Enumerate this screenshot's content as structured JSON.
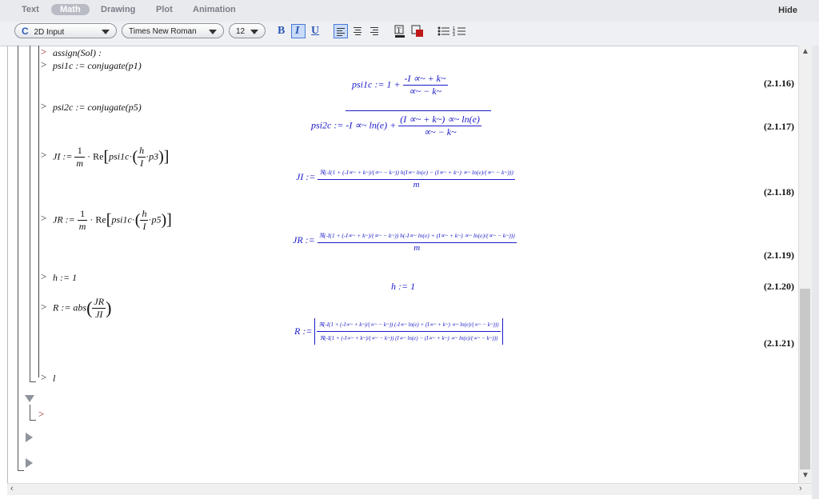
{
  "tabs": [
    {
      "label": "Text",
      "active": false
    },
    {
      "label": "Math",
      "active": true
    },
    {
      "label": "Drawing",
      "active": false
    },
    {
      "label": "Plot",
      "active": false
    },
    {
      "label": "Animation",
      "active": false
    }
  ],
  "hide_label": "Hide",
  "format_bar": {
    "input_mode": "2D Input",
    "input_mode_icon": "C",
    "font": "Times New Roman",
    "size": "12",
    "bold": "B",
    "italic": "I",
    "underline": "U"
  },
  "input_prompt": ">",
  "commands": {
    "assign": "assign(Sol) :",
    "psi1c": "psi1c := conjugate(p1)",
    "psi2c": "psi2c := conjugate(p5)",
    "JI_lhs": "JI :=",
    "JR_lhs": "JR :=",
    "h": "h := 1",
    "R_lhs": "R := abs",
    "one": "1",
    "m": "m",
    "Re": "Re",
    "psi1c_name": "psi1c",
    "h_sym": "h",
    "I_sym": "I",
    "p3": "p3",
    "p5": "p5",
    "JR_sym": "JR",
    "JI_sym": "JI",
    "cursor": "l"
  },
  "outputs": {
    "o16_lhs": "psi1c := 1 +",
    "o16_num": "-I ∝~ + k~",
    "o16_den": "∝~ − k~",
    "o17_lhs": "psi2c := -I ∝~ ln(e) +",
    "o17_num": "(I ∝~ + k~) ∝~ ln(e)",
    "o17_den": "∝~ − k~",
    "o18_lhs": "JI :=",
    "o18_num": "ℜ(-I(1 + (-I∝~ + k~)/(∝~ − k~)) h(I∝~ ln(e) − (I∝~ + k~) ∝~ ln(e)/(∝~ − k~)))",
    "o18_den": "m",
    "o19_lhs": "JR :=",
    "o19_num": "ℜ(-I(1 + (-I∝~ + k~)/(∝~ − k~)) h(-I∝~ ln(e) + (I∝~ + k~) ∝~ ln(e)/(∝~ − k~)))",
    "o19_den": "m",
    "o20": "h := 1",
    "o21_lhs": "R :=",
    "o21_num": "ℜ(-I(1 + (-I∝~ + k~)/(∝~ − k~)) (-I∝~ ln(e) + (I∝~ + k~) ∝~ ln(e)/(∝~ − k~)))",
    "o21_den": "ℜ(-I(1 + (-I∝~ + k~)/(∝~ − k~)) (I∝~ ln(e) − (I∝~ + k~) ∝~ ln(e)/(∝~ − k~)))"
  },
  "equation_labels": [
    "(2.1.16)",
    "(2.1.17)",
    "(2.1.18)",
    "(2.1.19)",
    "(2.1.20)",
    "(2.1.21)"
  ],
  "colors": {
    "output": "#1a1ac8",
    "accent": "#2b58b8"
  }
}
